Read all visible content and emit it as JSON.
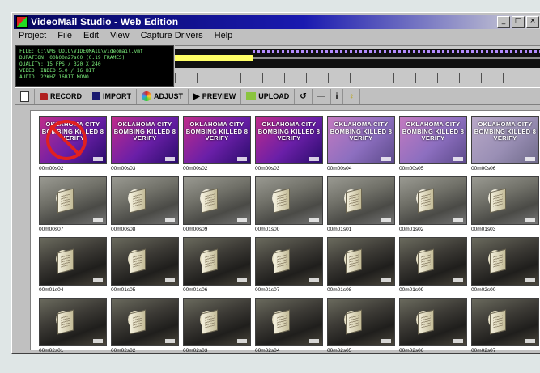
{
  "window": {
    "title": "VideoMail Studio - Web Edition",
    "buttons": {
      "minimize": "_",
      "maximize": "□",
      "close": "×"
    }
  },
  "menu": [
    "Project",
    "File",
    "Edit",
    "View",
    "Capture Drivers",
    "Help"
  ],
  "info_lines": [
    "FILE: C:\\VMSTUDIO\\VIDEOMAIL\\videomail.vmf",
    "DURATION: 00h00m27s00 (0.19 FRAMES)",
    "QUALITY: 15 FPS / 320 X 240",
    "VIDEO: INDEO 5.0 / 16 BIT",
    "AUDIO: 22KHZ 16BIT MONO"
  ],
  "toolbar": {
    "record": "RECORD",
    "import": "IMPORT",
    "adjust": "ADJUST",
    "preview": "PREVIEW",
    "upload": "UPLOAD"
  },
  "title_card_text": "OKLAHOMA CITY BOMBING KILLED 8 VERIFY",
  "thumbnails": [
    "00m00s02",
    "00m00s03",
    "00m00s02",
    "00m00s03",
    "00m00s04",
    "00m00s05",
    "00m00s06",
    "00m00s07",
    "00m00s08",
    "00m00s09",
    "00m01s00",
    "00m01s01",
    "00m01s02",
    "00m01s03",
    "00m01s04",
    "00m01s05",
    "00m01s06",
    "00m01s07",
    "00m01s08",
    "00m01s09",
    "00m02s00",
    "00m02s01",
    "00m02s02",
    "00m02s03",
    "00m02s04",
    "00m02s05",
    "00m02s06",
    "00m02s07"
  ]
}
